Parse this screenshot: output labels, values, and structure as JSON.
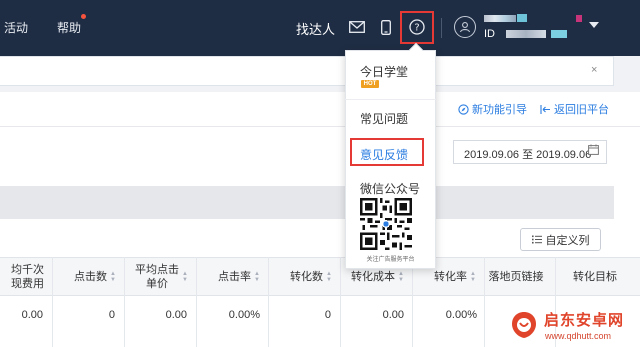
{
  "nav": {
    "activity": "活动",
    "help": "帮助",
    "talent": "找达人",
    "id_label": "ID"
  },
  "icons": {
    "mail": "mail-icon",
    "mobile": "mobile-icon",
    "help": "question-circle-icon",
    "user": "user-icon",
    "calendar": "calendar-icon",
    "list": "list-icon",
    "guide": "compass-icon",
    "back": "return-icon"
  },
  "toolbar": {
    "new_guide": "新功能引导",
    "back_old": "返回旧平台",
    "custom_columns": "自定义列"
  },
  "search": {
    "clear": "×"
  },
  "date_range": "2019.09.06 至 2019.09.06",
  "help_menu": {
    "today_academy": "今日学堂",
    "hot_badge": "HOT",
    "faq": "常见问题",
    "feedback": "意见反馈",
    "wechat": "微信公众号",
    "qr_caption": "关注广告服务平台"
  },
  "table": {
    "headers": [
      "均千次\n现费用",
      "点击数",
      "平均点击\n单价",
      "点击率",
      "转化数",
      "转化成本",
      "转化率",
      "落地页链接",
      "转化目标"
    ],
    "row": [
      "0.00",
      "0",
      "0.00",
      "0.00%",
      "0",
      "0.00",
      "0.00%",
      "",
      ""
    ]
  },
  "watermark": {
    "name": "启东安卓网",
    "url": "www.qdhutt.com"
  },
  "colors": {
    "topbar": "#1f2d44",
    "link": "#2b7de1",
    "highlight": "#e53935",
    "hot": "#f0a020"
  }
}
